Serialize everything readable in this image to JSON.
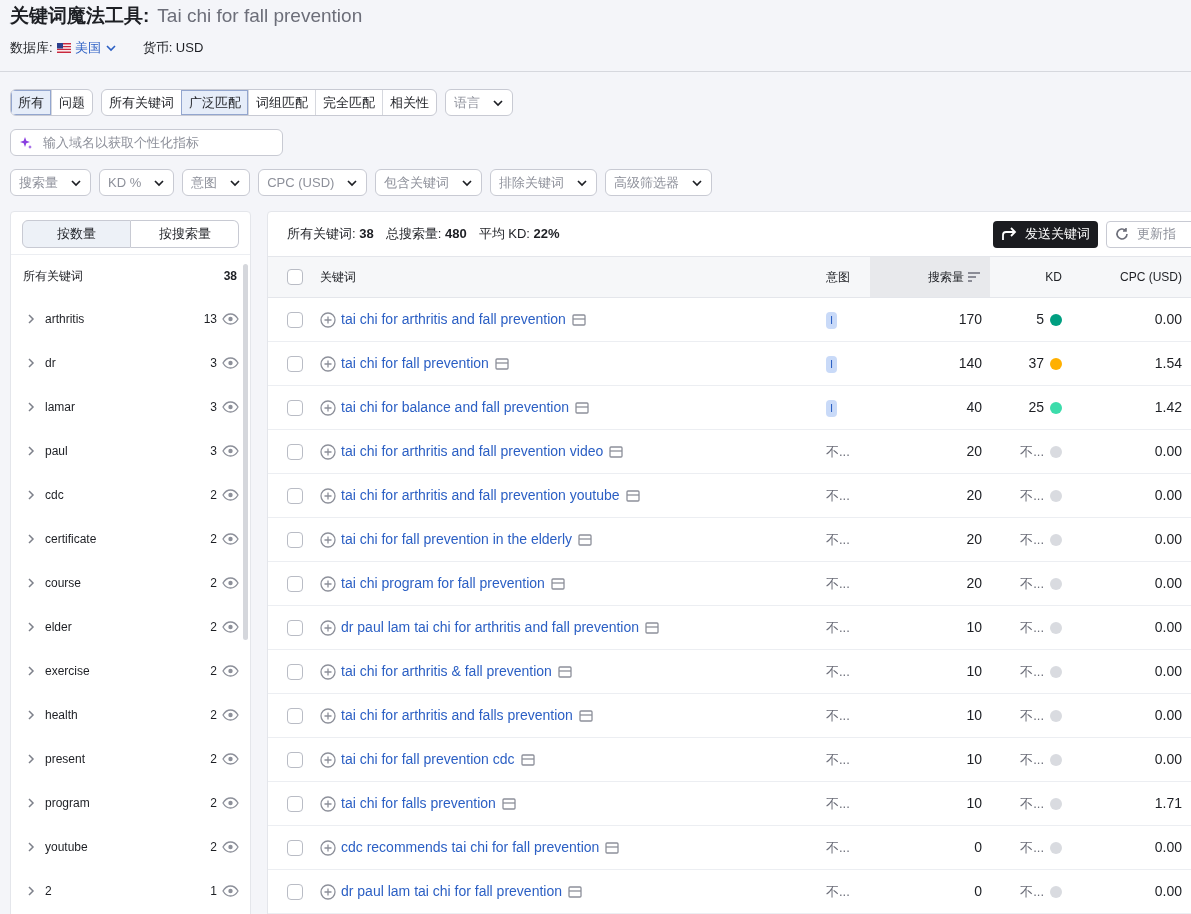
{
  "header": {
    "tool_name": "关键词魔法工具:",
    "query": "Tai chi for fall prevention",
    "database_label": "数据库:",
    "database_value": "美国",
    "currency": "货币: USD"
  },
  "type_tabs": [
    {
      "label": "所有",
      "selected": true
    },
    {
      "label": "问题",
      "selected": false
    }
  ],
  "match_tabs": [
    {
      "label": "所有关键词",
      "selected": false
    },
    {
      "label": "广泛匹配",
      "selected": true
    },
    {
      "label": "词组匹配",
      "selected": false
    },
    {
      "label": "完全匹配",
      "selected": false
    },
    {
      "label": "相关性",
      "selected": false
    }
  ],
  "language_dropdown": "语言",
  "domain_input": {
    "placeholder": "输入域名以获取个性化指标"
  },
  "filters": [
    "搜索量",
    "KD %",
    "意图",
    "CPC (USD)",
    "包含关键词",
    "排除关键词",
    "高级筛选器"
  ],
  "sidebar": {
    "sort_tabs": [
      {
        "label": "按数量",
        "selected": true
      },
      {
        "label": "按搜索量",
        "selected": false
      }
    ],
    "all_label": "所有关键词",
    "all_count": "38",
    "groups": [
      {
        "name": "arthritis",
        "count": "13"
      },
      {
        "name": "dr",
        "count": "3"
      },
      {
        "name": "lamar",
        "count": "3"
      },
      {
        "name": "paul",
        "count": "3"
      },
      {
        "name": "cdc",
        "count": "2"
      },
      {
        "name": "certificate",
        "count": "2"
      },
      {
        "name": "course",
        "count": "2"
      },
      {
        "name": "elder",
        "count": "2"
      },
      {
        "name": "exercise",
        "count": "2"
      },
      {
        "name": "health",
        "count": "2"
      },
      {
        "name": "present",
        "count": "2"
      },
      {
        "name": "program",
        "count": "2"
      },
      {
        "name": "youtube",
        "count": "2"
      },
      {
        "name": "2",
        "count": "1"
      }
    ]
  },
  "summary": [
    {
      "label": "所有关键词:",
      "value": "38"
    },
    {
      "label": "总搜索量:",
      "value": "480"
    },
    {
      "label": "平均 KD:",
      "value": "22%"
    }
  ],
  "send_button": "发送关键词",
  "update_button": "更新指",
  "table": {
    "header_checked": false,
    "columns": [
      "关键词",
      "意图",
      "搜索量",
      "KD",
      "CPC (USD)"
    ],
    "rows": [
      {
        "checked": false,
        "keyword": "tai chi for arthritis and fall prevention",
        "intent": {
          "kind": "badge",
          "text": "I"
        },
        "volume": "170",
        "kd": "5",
        "color": "#009f81",
        "cpc": "0.00"
      },
      {
        "checked": false,
        "keyword": "tai chi for fall prevention",
        "intent": {
          "kind": "badge",
          "text": "I"
        },
        "volume": "140",
        "kd": "37",
        "color": "#ffb000",
        "cpc": "1.54"
      },
      {
        "checked": false,
        "keyword": "tai chi for balance and fall prevention",
        "intent": {
          "kind": "badge",
          "text": "I"
        },
        "volume": "40",
        "kd": "25",
        "color": "#3cdcab",
        "cpc": "1.42"
      },
      {
        "checked": false,
        "keyword": "tai chi for arthritis and fall prevention video",
        "intent": {
          "kind": "text",
          "text": "不..."
        },
        "volume": "20",
        "kd": "不...",
        "color": "#d9dbe0",
        "cpc": "0.00"
      },
      {
        "checked": false,
        "keyword": "tai chi for arthritis and fall prevention youtube",
        "intent": {
          "kind": "text",
          "text": "不..."
        },
        "volume": "20",
        "kd": "不...",
        "color": "#d9dbe0",
        "cpc": "0.00"
      },
      {
        "checked": false,
        "keyword": "tai chi for fall prevention in the elderly",
        "intent": {
          "kind": "text",
          "text": "不..."
        },
        "volume": "20",
        "kd": "不...",
        "color": "#d9dbe0",
        "cpc": "0.00"
      },
      {
        "checked": false,
        "keyword": "tai chi program for fall prevention",
        "intent": {
          "kind": "text",
          "text": "不..."
        },
        "volume": "20",
        "kd": "不...",
        "color": "#d9dbe0",
        "cpc": "0.00"
      },
      {
        "checked": false,
        "keyword": "dr paul lam tai chi for arthritis and fall prevention",
        "intent": {
          "kind": "text",
          "text": "不..."
        },
        "volume": "10",
        "kd": "不...",
        "color": "#d9dbe0",
        "cpc": "0.00"
      },
      {
        "checked": false,
        "keyword": "tai chi for arthritis & fall prevention",
        "intent": {
          "kind": "text",
          "text": "不..."
        },
        "volume": "10",
        "kd": "不...",
        "color": "#d9dbe0",
        "cpc": "0.00"
      },
      {
        "checked": false,
        "keyword": "tai chi for arthritis and falls prevention",
        "intent": {
          "kind": "text",
          "text": "不..."
        },
        "volume": "10",
        "kd": "不...",
        "color": "#d9dbe0",
        "cpc": "0.00"
      },
      {
        "checked": false,
        "keyword": "tai chi for fall prevention cdc",
        "intent": {
          "kind": "text",
          "text": "不..."
        },
        "volume": "10",
        "kd": "不...",
        "color": "#d9dbe0",
        "cpc": "0.00"
      },
      {
        "checked": false,
        "keyword": "tai chi for falls prevention",
        "intent": {
          "kind": "text",
          "text": "不..."
        },
        "volume": "10",
        "kd": "不...",
        "color": "#d9dbe0",
        "cpc": "1.71"
      },
      {
        "checked": false,
        "keyword": "cdc recommends tai chi for fall prevention",
        "intent": {
          "kind": "text",
          "text": "不..."
        },
        "volume": "0",
        "kd": "不...",
        "color": "#d9dbe0",
        "cpc": "0.00"
      },
      {
        "checked": false,
        "keyword": "dr paul lam tai chi for fall prevention",
        "intent": {
          "kind": "text",
          "text": "不..."
        },
        "volume": "0",
        "kd": "不...",
        "color": "#d9dbe0",
        "cpc": "0.00"
      }
    ]
  }
}
